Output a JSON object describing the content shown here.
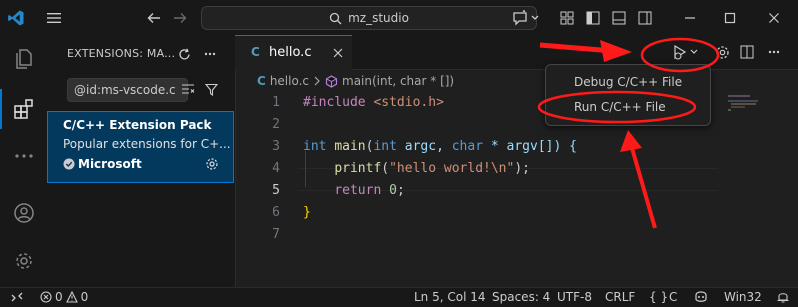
{
  "titlebar": {
    "search_text": "mz_studio"
  },
  "sidebar": {
    "title": "EXTENSIONS: MA...",
    "filter_value": "@id:ms-vscode.c",
    "extension": {
      "name": "C/C++ Extension Pack",
      "description": "Popular extensions for C+...",
      "publisher": "Microsoft"
    }
  },
  "editor": {
    "tab_label": "hello.c",
    "tab_icon": "C",
    "breadcrumb": {
      "file": "hello.c",
      "symbol": "main(int, char * [])"
    },
    "line_numbers": [
      "1",
      "2",
      "3",
      "4",
      "5",
      "6",
      "7"
    ],
    "code": {
      "l1_directive": "#include",
      "l1_header": "<stdio.h>",
      "l3_int": "int",
      "l3_main": "main",
      "l3_open": "(",
      "l3_int2": "int",
      "l3_argc": "argc, ",
      "l3_char": "char",
      "l3_argv": " * argv[]) {",
      "l4_printf": "printf",
      "l4_open": "(",
      "l4_str": "\"hello world!\\n\"",
      "l4_close": ");",
      "l5_return": "return",
      "l5_zero": "0",
      "l5_semi": ";",
      "l6_brace": "}"
    }
  },
  "menu": {
    "items": [
      "Debug C/C++ File",
      "Run C/C++ File"
    ]
  },
  "status": {
    "errors": "0",
    "warnings": "0",
    "position": "Ln 5, Col 14",
    "spaces": "Spaces: 4",
    "encoding": "UTF-8",
    "eol": "CRLF",
    "language": "C",
    "platform": "Win32",
    "braces": "{ }"
  },
  "colors": {
    "accent": "#0078d4",
    "annotation": "#ff1a1a"
  }
}
